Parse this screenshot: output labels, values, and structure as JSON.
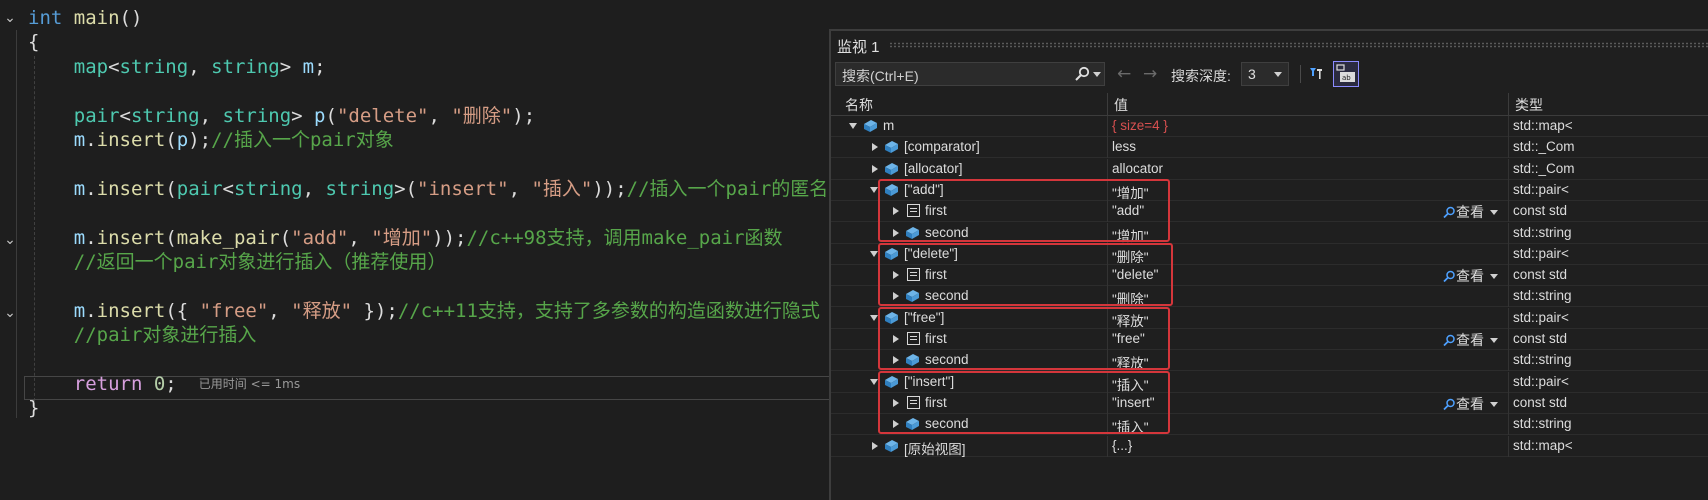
{
  "editor": {
    "lines": [
      [
        {
          "t": "int ",
          "c": "kw"
        },
        {
          "t": "main",
          "c": "fn"
        },
        {
          "t": "()",
          "c": "pl"
        }
      ],
      [
        {
          "t": "{",
          "c": "pl"
        }
      ],
      [
        {
          "t": "    ",
          "c": "pl"
        },
        {
          "t": "map",
          "c": "ty"
        },
        {
          "t": "<",
          "c": "pl"
        },
        {
          "t": "string",
          "c": "ty"
        },
        {
          "t": ", ",
          "c": "pl"
        },
        {
          "t": "string",
          "c": "ty"
        },
        {
          "t": "> ",
          "c": "pl"
        },
        {
          "t": "m",
          "c": "var"
        },
        {
          "t": ";",
          "c": "pl"
        }
      ],
      [],
      [
        {
          "t": "    ",
          "c": "pl"
        },
        {
          "t": "pair",
          "c": "ty"
        },
        {
          "t": "<",
          "c": "pl"
        },
        {
          "t": "string",
          "c": "ty"
        },
        {
          "t": ", ",
          "c": "pl"
        },
        {
          "t": "string",
          "c": "ty"
        },
        {
          "t": "> ",
          "c": "pl"
        },
        {
          "t": "p",
          "c": "var"
        },
        {
          "t": "(",
          "c": "pl"
        },
        {
          "t": "\"delete\"",
          "c": "st"
        },
        {
          "t": ", ",
          "c": "pl"
        },
        {
          "t": "\"删除\"",
          "c": "st"
        },
        {
          "t": ");",
          "c": "pl"
        }
      ],
      [
        {
          "t": "    ",
          "c": "pl"
        },
        {
          "t": "m",
          "c": "var"
        },
        {
          "t": ".",
          "c": "pl"
        },
        {
          "t": "insert",
          "c": "fn"
        },
        {
          "t": "(",
          "c": "pl"
        },
        {
          "t": "p",
          "c": "var"
        },
        {
          "t": ");",
          "c": "pl"
        },
        {
          "t": "//插入一个pair对象",
          "c": "cm"
        }
      ],
      [],
      [
        {
          "t": "    ",
          "c": "pl"
        },
        {
          "t": "m",
          "c": "var"
        },
        {
          "t": ".",
          "c": "pl"
        },
        {
          "t": "insert",
          "c": "fn"
        },
        {
          "t": "(",
          "c": "pl"
        },
        {
          "t": "pair",
          "c": "ty"
        },
        {
          "t": "<",
          "c": "pl"
        },
        {
          "t": "string",
          "c": "ty"
        },
        {
          "t": ", ",
          "c": "pl"
        },
        {
          "t": "string",
          "c": "ty"
        },
        {
          "t": ">(",
          "c": "pl"
        },
        {
          "t": "\"insert\"",
          "c": "st"
        },
        {
          "t": ", ",
          "c": "pl"
        },
        {
          "t": "\"插入\"",
          "c": "st"
        },
        {
          "t": "));",
          "c": "pl"
        },
        {
          "t": "//插入一个pair的匿名",
          "c": "cm"
        }
      ],
      [],
      [
        {
          "t": "    ",
          "c": "pl"
        },
        {
          "t": "m",
          "c": "var"
        },
        {
          "t": ".",
          "c": "pl"
        },
        {
          "t": "insert",
          "c": "fn"
        },
        {
          "t": "(",
          "c": "pl"
        },
        {
          "t": "make_pair",
          "c": "fn"
        },
        {
          "t": "(",
          "c": "pl"
        },
        {
          "t": "\"add\"",
          "c": "st"
        },
        {
          "t": ", ",
          "c": "pl"
        },
        {
          "t": "\"增加\"",
          "c": "st"
        },
        {
          "t": "));",
          "c": "pl"
        },
        {
          "t": "//c++98支持，调用make_pair函数",
          "c": "cm"
        }
      ],
      [
        {
          "t": "    ",
          "c": "pl"
        },
        {
          "t": "//返回一个pair对象进行插入（推荐使用）",
          "c": "cm"
        }
      ],
      [],
      [
        {
          "t": "    ",
          "c": "pl"
        },
        {
          "t": "m",
          "c": "var"
        },
        {
          "t": ".",
          "c": "pl"
        },
        {
          "t": "insert",
          "c": "fn"
        },
        {
          "t": "({ ",
          "c": "pl"
        },
        {
          "t": "\"free\"",
          "c": "st"
        },
        {
          "t": ", ",
          "c": "pl"
        },
        {
          "t": "\"释放\"",
          "c": "st"
        },
        {
          "t": " });",
          "c": "pl"
        },
        {
          "t": "//c++11支持，支持了多参数的构造函数进行隐式",
          "c": "cm"
        }
      ],
      [
        {
          "t": "    ",
          "c": "pl"
        },
        {
          "t": "//pair对象进行插入",
          "c": "cm"
        }
      ],
      [],
      [
        {
          "t": "    ",
          "c": "pl"
        },
        {
          "t": "return ",
          "c": "ctl"
        },
        {
          "t": "0",
          "c": "nu"
        },
        {
          "t": ";",
          "c": "pl"
        }
      ],
      [
        {
          "t": "}",
          "c": "pl"
        }
      ]
    ],
    "elapsed_hint": "已用时间 <= 1ms"
  },
  "watch": {
    "title": "监视 1",
    "search_placeholder": "搜索(Ctrl+E)",
    "depth_label": "搜索深度:",
    "depth_value": "3",
    "col_name": "名称",
    "col_value": "值",
    "col_type": "类型",
    "view_label": "查看",
    "rows": [
      {
        "name": "m",
        "value": "{ size=4 }",
        "type": "std::map<",
        "level": 0,
        "expand": "open",
        "icon": "obj",
        "value_color": "#d85050"
      },
      {
        "name": "[comparator]",
        "value": "less",
        "type": "std::_Com",
        "level": 1,
        "expand": "closed",
        "icon": "obj"
      },
      {
        "name": "[allocator]",
        "value": "allocator",
        "type": "std::_Com",
        "level": 1,
        "expand": "closed",
        "icon": "obj"
      },
      {
        "name": "[\"add\"]",
        "value": "\"增加\"",
        "type": "std::pair<",
        "level": 1,
        "expand": "open",
        "icon": "obj"
      },
      {
        "name": "first",
        "value": "\"add\"",
        "type": "const std",
        "level": 2,
        "expand": "closed",
        "icon": "field",
        "view": true
      },
      {
        "name": "second",
        "value": "\"增加\"",
        "type": "std::string",
        "level": 2,
        "expand": "closed",
        "icon": "obj"
      },
      {
        "name": "[\"delete\"]",
        "value": "\"删除\"",
        "type": "std::pair<",
        "level": 1,
        "expand": "open",
        "icon": "obj"
      },
      {
        "name": "first",
        "value": "\"delete\"",
        "type": "const std",
        "level": 2,
        "expand": "closed",
        "icon": "field",
        "view": true
      },
      {
        "name": "second",
        "value": "\"删除\"",
        "type": "std::string",
        "level": 2,
        "expand": "closed",
        "icon": "obj"
      },
      {
        "name": "[\"free\"]",
        "value": "\"释放\"",
        "type": "std::pair<",
        "level": 1,
        "expand": "open",
        "icon": "obj"
      },
      {
        "name": "first",
        "value": "\"free\"",
        "type": "const std",
        "level": 2,
        "expand": "closed",
        "icon": "field",
        "view": true
      },
      {
        "name": "second",
        "value": "\"释放\"",
        "type": "std::string",
        "level": 2,
        "expand": "closed",
        "icon": "obj"
      },
      {
        "name": "[\"insert\"]",
        "value": "\"插入\"",
        "type": "std::pair<",
        "level": 1,
        "expand": "open",
        "icon": "obj"
      },
      {
        "name": "first",
        "value": "\"insert\"",
        "type": "const std",
        "level": 2,
        "expand": "closed",
        "icon": "field",
        "view": true
      },
      {
        "name": "second",
        "value": "\"插入\"",
        "type": "std::string",
        "level": 2,
        "expand": "closed",
        "icon": "obj"
      },
      {
        "name": "[原始视图]",
        "value": "{...}",
        "type": "std::map<",
        "level": 1,
        "expand": "closed",
        "icon": "obj"
      }
    ]
  },
  "colors": {
    "highlight_box": "#d4363b",
    "watch_accent": "#8b8bff"
  }
}
